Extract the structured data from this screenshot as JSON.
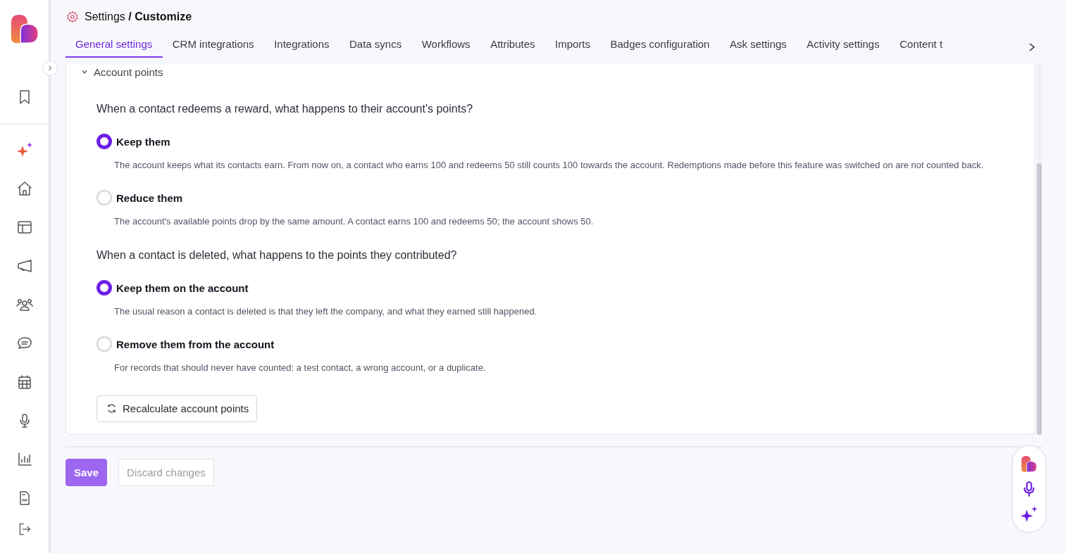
{
  "header": {
    "parent": "Settings",
    "separator": "/",
    "current": "Customize"
  },
  "tabs": [
    {
      "label": "General settings",
      "selected": true
    },
    {
      "label": "CRM integrations",
      "selected": false
    },
    {
      "label": "Integrations",
      "selected": false
    },
    {
      "label": "Data syncs",
      "selected": false
    },
    {
      "label": "Workflows",
      "selected": false
    },
    {
      "label": "Attributes",
      "selected": false
    },
    {
      "label": "Imports",
      "selected": false
    },
    {
      "label": "Badges configuration",
      "selected": false
    },
    {
      "label": "Ask settings",
      "selected": false
    },
    {
      "label": "Activity settings",
      "selected": false
    },
    {
      "label": "Content t",
      "selected": false
    }
  ],
  "section": {
    "title": "Account points"
  },
  "questions": [
    {
      "question": "When a contact redeems a reward, what happens to their account's points?",
      "options": [
        {
          "label": "Keep them",
          "description": "The account keeps what its contacts earn. From now on, a contact who earns 100 and redeems 50 still counts 100 towards the account. Redemptions made before this feature was switched on are not counted back.",
          "selected": true
        },
        {
          "label": "Reduce them",
          "description": "The account's available points drop by the same amount. A contact earns 100 and redeems 50; the account shows 50.",
          "selected": false
        }
      ]
    },
    {
      "question": "When a contact is deleted, what happens to the points they contributed?",
      "options": [
        {
          "label": "Keep them on the account",
          "description": "The usual reason a contact is deleted is that they left the company, and what they earned still happened.",
          "selected": true
        },
        {
          "label": "Remove them from the account",
          "description": "For records that should never have counted: a test contact, a wrong account, or a duplicate.",
          "selected": false
        }
      ]
    }
  ],
  "recalculate_button": "Recalculate account points",
  "footer_buttons": [
    {
      "label": "Save",
      "kind": "primary"
    },
    {
      "label": "Discard changes",
      "kind": "secondary"
    }
  ]
}
